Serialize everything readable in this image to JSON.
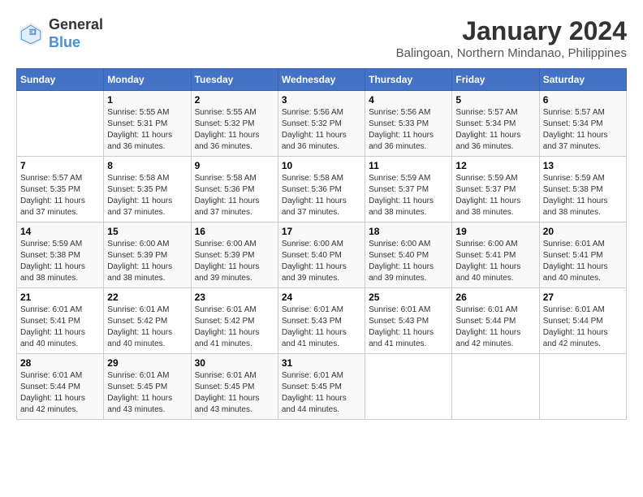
{
  "header": {
    "logo_general": "General",
    "logo_blue": "Blue",
    "title": "January 2024",
    "subtitle": "Balingoan, Northern Mindanao, Philippines"
  },
  "weekdays": [
    "Sunday",
    "Monday",
    "Tuesday",
    "Wednesday",
    "Thursday",
    "Friday",
    "Saturday"
  ],
  "weeks": [
    [
      {
        "day": "",
        "info": ""
      },
      {
        "day": "1",
        "info": "Sunrise: 5:55 AM\nSunset: 5:31 PM\nDaylight: 11 hours\nand 36 minutes."
      },
      {
        "day": "2",
        "info": "Sunrise: 5:55 AM\nSunset: 5:32 PM\nDaylight: 11 hours\nand 36 minutes."
      },
      {
        "day": "3",
        "info": "Sunrise: 5:56 AM\nSunset: 5:32 PM\nDaylight: 11 hours\nand 36 minutes."
      },
      {
        "day": "4",
        "info": "Sunrise: 5:56 AM\nSunset: 5:33 PM\nDaylight: 11 hours\nand 36 minutes."
      },
      {
        "day": "5",
        "info": "Sunrise: 5:57 AM\nSunset: 5:34 PM\nDaylight: 11 hours\nand 36 minutes."
      },
      {
        "day": "6",
        "info": "Sunrise: 5:57 AM\nSunset: 5:34 PM\nDaylight: 11 hours\nand 37 minutes."
      }
    ],
    [
      {
        "day": "7",
        "info": "Sunrise: 5:57 AM\nSunset: 5:35 PM\nDaylight: 11 hours\nand 37 minutes."
      },
      {
        "day": "8",
        "info": "Sunrise: 5:58 AM\nSunset: 5:35 PM\nDaylight: 11 hours\nand 37 minutes."
      },
      {
        "day": "9",
        "info": "Sunrise: 5:58 AM\nSunset: 5:36 PM\nDaylight: 11 hours\nand 37 minutes."
      },
      {
        "day": "10",
        "info": "Sunrise: 5:58 AM\nSunset: 5:36 PM\nDaylight: 11 hours\nand 37 minutes."
      },
      {
        "day": "11",
        "info": "Sunrise: 5:59 AM\nSunset: 5:37 PM\nDaylight: 11 hours\nand 38 minutes."
      },
      {
        "day": "12",
        "info": "Sunrise: 5:59 AM\nSunset: 5:37 PM\nDaylight: 11 hours\nand 38 minutes."
      },
      {
        "day": "13",
        "info": "Sunrise: 5:59 AM\nSunset: 5:38 PM\nDaylight: 11 hours\nand 38 minutes."
      }
    ],
    [
      {
        "day": "14",
        "info": "Sunrise: 5:59 AM\nSunset: 5:38 PM\nDaylight: 11 hours\nand 38 minutes."
      },
      {
        "day": "15",
        "info": "Sunrise: 6:00 AM\nSunset: 5:39 PM\nDaylight: 11 hours\nand 38 minutes."
      },
      {
        "day": "16",
        "info": "Sunrise: 6:00 AM\nSunset: 5:39 PM\nDaylight: 11 hours\nand 39 minutes."
      },
      {
        "day": "17",
        "info": "Sunrise: 6:00 AM\nSunset: 5:40 PM\nDaylight: 11 hours\nand 39 minutes."
      },
      {
        "day": "18",
        "info": "Sunrise: 6:00 AM\nSunset: 5:40 PM\nDaylight: 11 hours\nand 39 minutes."
      },
      {
        "day": "19",
        "info": "Sunrise: 6:00 AM\nSunset: 5:41 PM\nDaylight: 11 hours\nand 40 minutes."
      },
      {
        "day": "20",
        "info": "Sunrise: 6:01 AM\nSunset: 5:41 PM\nDaylight: 11 hours\nand 40 minutes."
      }
    ],
    [
      {
        "day": "21",
        "info": "Sunrise: 6:01 AM\nSunset: 5:41 PM\nDaylight: 11 hours\nand 40 minutes."
      },
      {
        "day": "22",
        "info": "Sunrise: 6:01 AM\nSunset: 5:42 PM\nDaylight: 11 hours\nand 40 minutes."
      },
      {
        "day": "23",
        "info": "Sunrise: 6:01 AM\nSunset: 5:42 PM\nDaylight: 11 hours\nand 41 minutes."
      },
      {
        "day": "24",
        "info": "Sunrise: 6:01 AM\nSunset: 5:43 PM\nDaylight: 11 hours\nand 41 minutes."
      },
      {
        "day": "25",
        "info": "Sunrise: 6:01 AM\nSunset: 5:43 PM\nDaylight: 11 hours\nand 41 minutes."
      },
      {
        "day": "26",
        "info": "Sunrise: 6:01 AM\nSunset: 5:44 PM\nDaylight: 11 hours\nand 42 minutes."
      },
      {
        "day": "27",
        "info": "Sunrise: 6:01 AM\nSunset: 5:44 PM\nDaylight: 11 hours\nand 42 minutes."
      }
    ],
    [
      {
        "day": "28",
        "info": "Sunrise: 6:01 AM\nSunset: 5:44 PM\nDaylight: 11 hours\nand 42 minutes."
      },
      {
        "day": "29",
        "info": "Sunrise: 6:01 AM\nSunset: 5:45 PM\nDaylight: 11 hours\nand 43 minutes."
      },
      {
        "day": "30",
        "info": "Sunrise: 6:01 AM\nSunset: 5:45 PM\nDaylight: 11 hours\nand 43 minutes."
      },
      {
        "day": "31",
        "info": "Sunrise: 6:01 AM\nSunset: 5:45 PM\nDaylight: 11 hours\nand 44 minutes."
      },
      {
        "day": "",
        "info": ""
      },
      {
        "day": "",
        "info": ""
      },
      {
        "day": "",
        "info": ""
      }
    ]
  ]
}
